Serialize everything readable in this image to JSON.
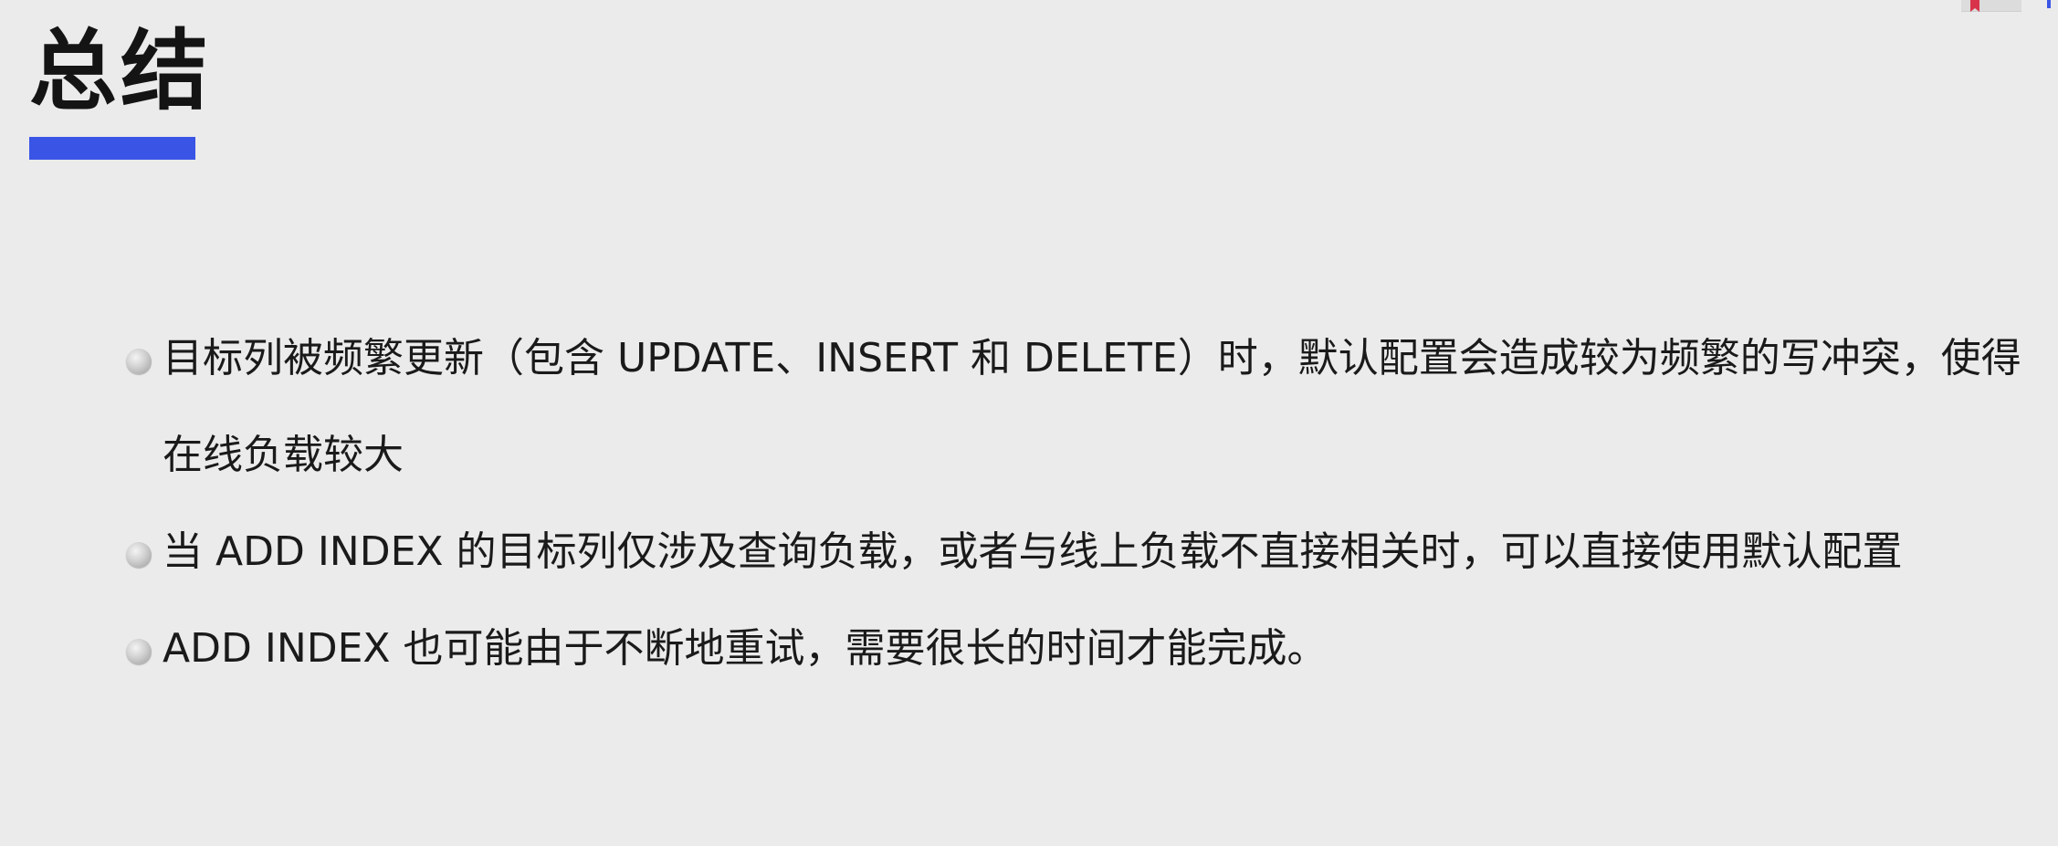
{
  "title": "总结",
  "accent_color": "#3a55e6",
  "bullet_icon": "gray-disc-bullet",
  "bullets": [
    {
      "text": "目标列被频繁更新（包含 UPDATE、INSERT 和 DELETE）时，默认配置会造成较为频繁的写冲突，使得在线负载较大"
    },
    {
      "text": "当 ADD INDEX 的目标列仅涉及查询负载，或者与线上负载不直接相关时，可以直接使用默认配置"
    },
    {
      "text": "ADD INDEX 也可能由于不断地重试，需要很长的时间才能完成。"
    }
  ]
}
